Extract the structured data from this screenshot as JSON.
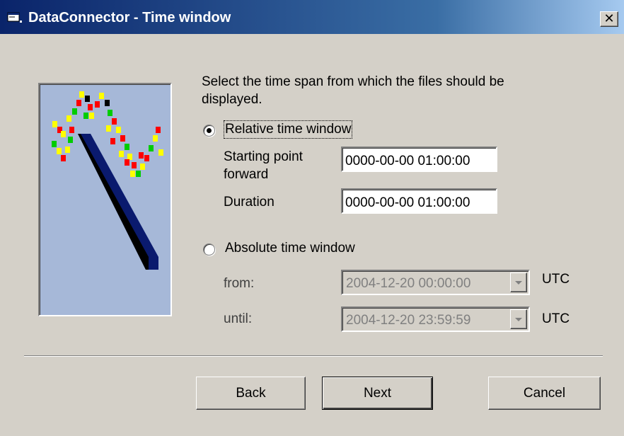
{
  "window": {
    "title": "DataConnector - Time window",
    "app_icon": "app-window-icon",
    "close_symbol": "✕"
  },
  "intro_text_line1": "Select the time span from which the files should be",
  "intro_text_line2": "displayed.",
  "relative": {
    "label": "Relative time window",
    "selected": true,
    "starting_point_label_line1": "Starting point",
    "starting_point_label_line2": "forward",
    "starting_point_value": "0000-00-00 01:00:00",
    "duration_label": "Duration",
    "duration_value": "0000-00-00 01:00:00"
  },
  "absolute": {
    "label": "Absolute time window",
    "selected": false,
    "from_label": "from:",
    "from_value": "2004-12-20 00:00:00",
    "from_tz": "UTC",
    "until_label": "until:",
    "until_value": "2004-12-20 23:59:59",
    "until_tz": "UTC"
  },
  "buttons": {
    "back": "Back",
    "next": "Next",
    "cancel": "Cancel"
  },
  "colors": {
    "titlebar_start": "#0a246a",
    "titlebar_end": "#a6caf0",
    "face": "#d4d0c8",
    "picture_bg": "#a6b8d8",
    "line": "#0a1a6e"
  }
}
